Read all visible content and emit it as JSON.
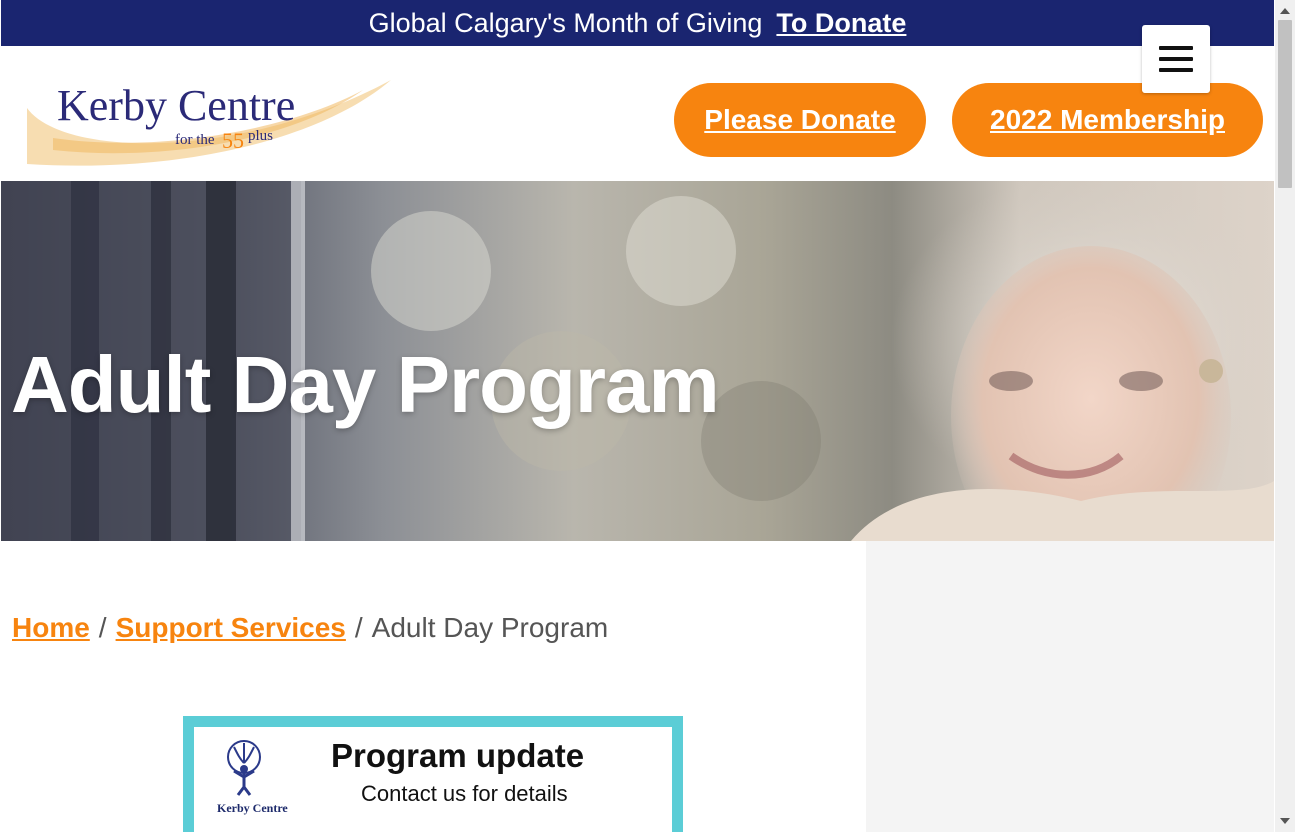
{
  "announcement": {
    "text": "Global Calgary's Month of Giving",
    "link_label": "To Donate"
  },
  "header": {
    "logo": {
      "name": "Kerby Centre",
      "tagline_prefix": "for the",
      "tagline_number": "55",
      "tagline_suffix": "plus"
    },
    "donate_button": "Please Donate",
    "membership_button": "2022 Membership",
    "menu_icon": "hamburger-icon"
  },
  "hero": {
    "title": "Adult Day Program"
  },
  "breadcrumb": {
    "items": [
      "Home",
      "Support Services",
      "Adult Day Program"
    ],
    "separator": "/"
  },
  "program_card": {
    "logo_label": "Kerby Centre",
    "title": "Program update",
    "subtitle": "Contact us for details"
  },
  "colors": {
    "navy": "#1a2570",
    "orange": "#f7840f",
    "teal": "#5bcdd6"
  }
}
